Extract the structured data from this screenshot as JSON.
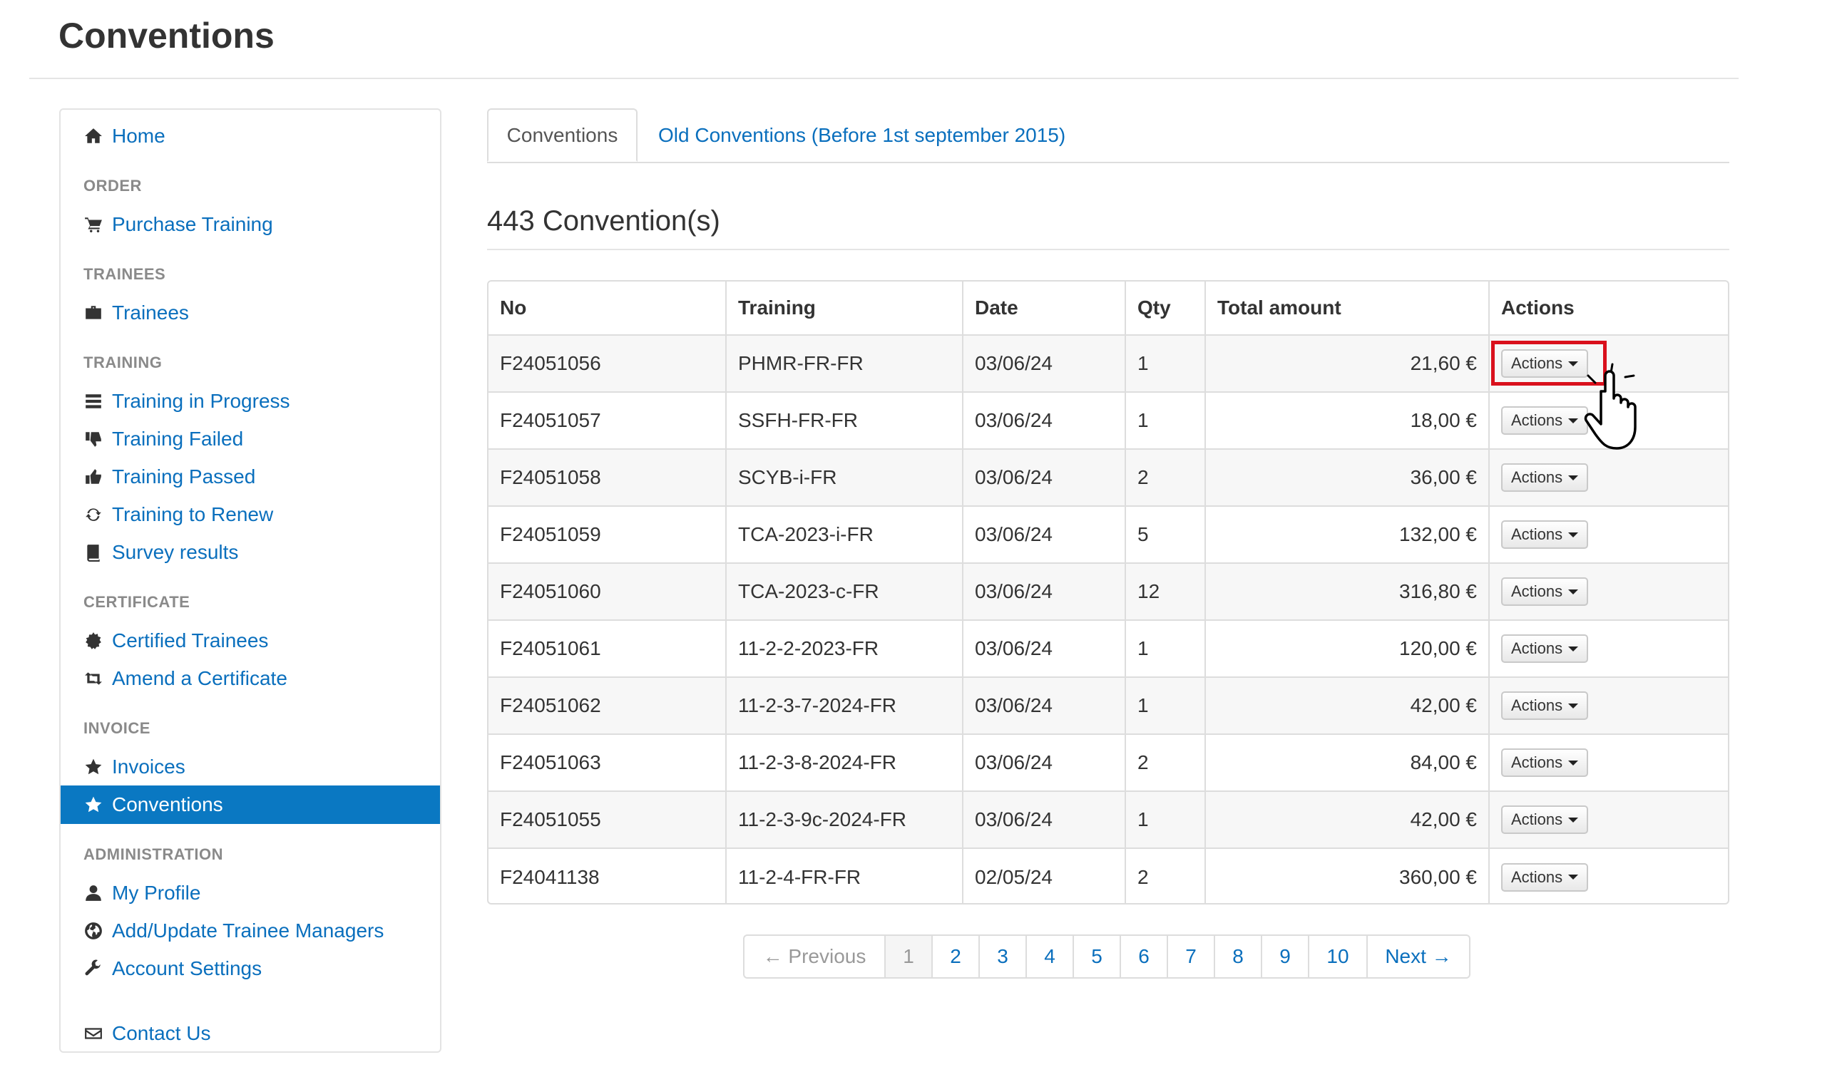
{
  "page": {
    "title": "Conventions"
  },
  "sidebar": {
    "home": "Home",
    "sections": {
      "order": "ORDER",
      "trainees": "TRAINEES",
      "training": "TRAINING",
      "certificate": "CERTIFICATE",
      "invoice": "INVOICE",
      "administration": "ADMINISTRATION"
    },
    "items": {
      "purchase_training": "Purchase Training",
      "trainees": "Trainees",
      "training_in_progress": "Training in Progress",
      "training_failed": "Training Failed",
      "training_passed": "Training Passed",
      "training_to_renew": "Training to Renew",
      "survey_results": "Survey results",
      "certified_trainees": "Certified Trainees",
      "amend_certificate": "Amend a Certificate",
      "invoices": "Invoices",
      "conventions": "Conventions",
      "my_profile": "My Profile",
      "trainee_managers": "Add/Update Trainee Managers",
      "account_settings": "Account Settings",
      "contact_us": "Contact Us"
    },
    "active_item": "conventions",
    "icons": {
      "home": "home-icon",
      "purchase_training": "cart-icon",
      "trainees": "briefcase-icon",
      "training_in_progress": "list-icon",
      "training_failed": "thumbs-down-icon",
      "training_passed": "thumbs-up-icon",
      "training_to_renew": "refresh-icon",
      "survey_results": "book-icon",
      "certified_trainees": "certificate-icon",
      "amend_certificate": "retweet-icon",
      "invoices": "star-icon",
      "conventions": "star-icon",
      "my_profile": "user-icon",
      "trainee_managers": "globe-icon",
      "account_settings": "wrench-icon",
      "contact_us": "envelope-icon"
    }
  },
  "tabs": [
    {
      "label": "Conventions",
      "active": true
    },
    {
      "label": "Old Conventions (Before 1st september 2015)",
      "active": false
    }
  ],
  "summary": {
    "count_title": "443 Convention(s)"
  },
  "table": {
    "headers": [
      "No",
      "Training",
      "Date",
      "Qty",
      "Total amount",
      "Actions"
    ],
    "action_label": "Actions",
    "rows": [
      {
        "no": "F24051056",
        "training": "PHMR-FR-FR",
        "date": "03/06/24",
        "qty": "1",
        "amount": "21,60 €"
      },
      {
        "no": "F24051057",
        "training": "SSFH-FR-FR",
        "date": "03/06/24",
        "qty": "1",
        "amount": "18,00 €"
      },
      {
        "no": "F24051058",
        "training": "SCYB-i-FR",
        "date": "03/06/24",
        "qty": "2",
        "amount": "36,00 €"
      },
      {
        "no": "F24051059",
        "training": "TCA-2023-i-FR",
        "date": "03/06/24",
        "qty": "5",
        "amount": "132,00 €"
      },
      {
        "no": "F24051060",
        "training": "TCA-2023-c-FR",
        "date": "03/06/24",
        "qty": "12",
        "amount": "316,80 €"
      },
      {
        "no": "F24051061",
        "training": "11-2-2-2023-FR",
        "date": "03/06/24",
        "qty": "1",
        "amount": "120,00 €"
      },
      {
        "no": "F24051062",
        "training": "11-2-3-7-2024-FR",
        "date": "03/06/24",
        "qty": "1",
        "amount": "42,00 €"
      },
      {
        "no": "F24051063",
        "training": "11-2-3-8-2024-FR",
        "date": "03/06/24",
        "qty": "2",
        "amount": "84,00 €"
      },
      {
        "no": "F24051055",
        "training": "11-2-3-9c-2024-FR",
        "date": "03/06/24",
        "qty": "1",
        "amount": "42,00 €"
      },
      {
        "no": "F24041138",
        "training": "11-2-4-FR-FR",
        "date": "02/05/24",
        "qty": "2",
        "amount": "360,00 €"
      }
    ]
  },
  "pagination": {
    "previous": "← Previous",
    "pages": [
      "1",
      "2",
      "3",
      "4",
      "5",
      "6",
      "7",
      "8",
      "9",
      "10"
    ],
    "current": "1",
    "next": "Next →"
  },
  "colors": {
    "link": "#0a6fbd",
    "active_nav_bg": "#0a78c2",
    "highlight": "#d9101c"
  }
}
